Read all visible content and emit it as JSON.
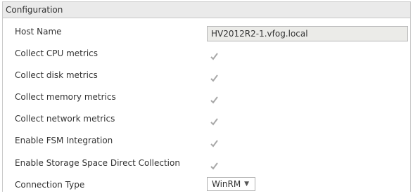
{
  "panel": {
    "title": "Configuration"
  },
  "fields": {
    "host_name": {
      "label": "Host Name",
      "value": "HV2012R2-1.vfog.local"
    },
    "collect_cpu": {
      "label": "Collect CPU metrics",
      "checked": true
    },
    "collect_disk": {
      "label": "Collect disk metrics",
      "checked": true
    },
    "collect_memory": {
      "label": "Collect memory metrics",
      "checked": true
    },
    "collect_network": {
      "label": "Collect network metrics",
      "checked": true
    },
    "enable_fsm": {
      "label": "Enable FSM Integration",
      "checked": true
    },
    "enable_s2d": {
      "label": "Enable Storage Space Direct Collection",
      "checked": true
    },
    "connection_type": {
      "label": "Connection Type",
      "value": "WinRM"
    }
  },
  "icons": {
    "checkmark": "check-icon",
    "dropdown": "chevron-down-icon"
  },
  "colors": {
    "header_bg": "#eaeaea",
    "border": "#c9c9c9",
    "disabled_field_bg": "#ebebe8",
    "checkmark_disabled": "#a8a8a8"
  }
}
